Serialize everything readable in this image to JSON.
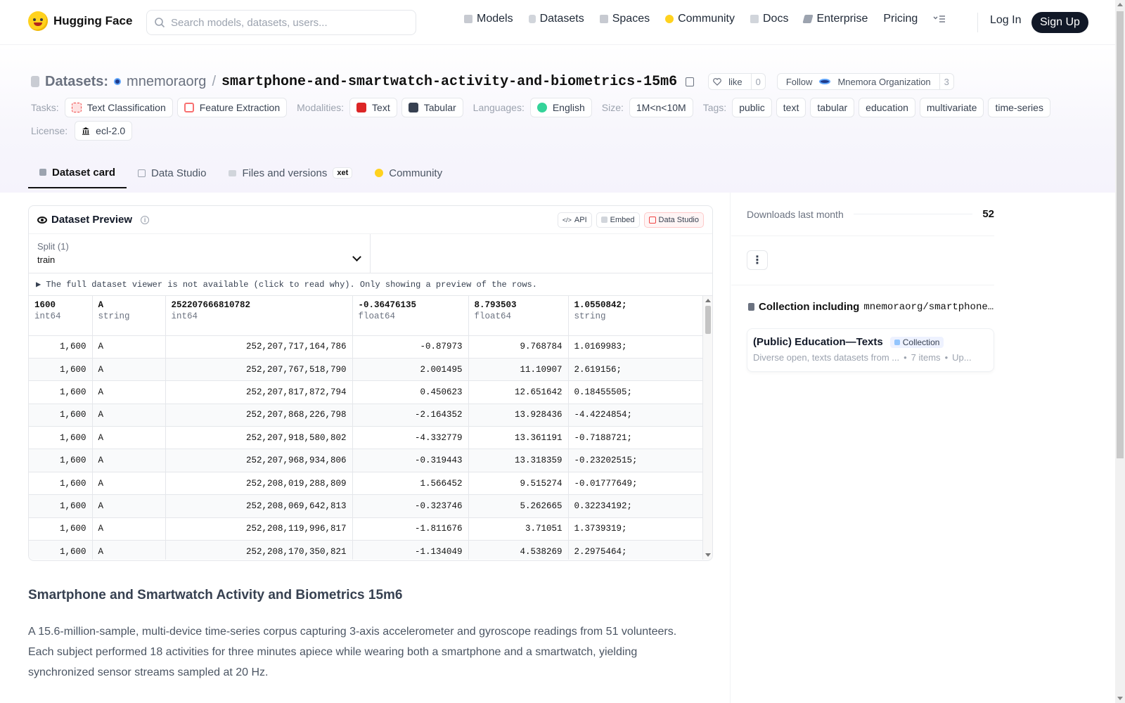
{
  "nav": {
    "brand": "Hugging Face",
    "search_placeholder": "Search models, datasets, users...",
    "links": [
      "Models",
      "Datasets",
      "Spaces",
      "Community",
      "Docs",
      "Enterprise",
      "Pricing"
    ],
    "login": "Log In",
    "signup": "Sign Up"
  },
  "header": {
    "crumb_label": "Datasets:",
    "org": "mnemoraorg",
    "repo": "smartphone-and-smartwatch-activity-and-biometrics-15m6",
    "like_label": "like",
    "like_count": "0",
    "follow_label": "Follow",
    "follow_org": "Mnemora Organization",
    "follow_count": "3"
  },
  "tags": {
    "tasks_label": "Tasks:",
    "tasks": [
      "Text Classification",
      "Feature Extraction"
    ],
    "modalities_label": "Modalities:",
    "modalities": [
      "Text",
      "Tabular"
    ],
    "languages_label": "Languages:",
    "languages": [
      "English"
    ],
    "size_label": "Size:",
    "size": "1M<n<10M",
    "tags_label": "Tags:",
    "tags": [
      "public",
      "text",
      "tabular",
      "education",
      "multivariate",
      "time-series"
    ],
    "license_label": "License:",
    "license": "ecl-2.0"
  },
  "tabs": [
    "Dataset card",
    "Data Studio",
    "Files and versions",
    "Community"
  ],
  "xet_badge": "xet",
  "preview": {
    "title": "Dataset Preview",
    "btn_api": "API",
    "btn_embed": "Embed",
    "btn_studio": "Data Studio",
    "split_label": "Split (1)",
    "split_value": "train",
    "notice": "▶ The full dataset viewer is not available (click to read why). Only showing a preview of the rows.",
    "columns": [
      {
        "name": "1600",
        "dtype": "int64"
      },
      {
        "name": "A",
        "dtype": "string"
      },
      {
        "name": "252207666810782",
        "dtype": "int64"
      },
      {
        "name": "-0.36476135",
        "dtype": "float64"
      },
      {
        "name": "8.793503",
        "dtype": "float64"
      },
      {
        "name": "1.0550842;",
        "dtype": "string"
      }
    ],
    "rows": [
      [
        "1,600",
        "A",
        "252,207,717,164,786",
        "-0.87973",
        "9.768784",
        "1.0169983;"
      ],
      [
        "1,600",
        "A",
        "252,207,767,518,790",
        "2.001495",
        "11.10907",
        "2.619156;"
      ],
      [
        "1,600",
        "A",
        "252,207,817,872,794",
        "0.450623",
        "12.651642",
        "0.18455505;"
      ],
      [
        "1,600",
        "A",
        "252,207,868,226,798",
        "-2.164352",
        "13.928436",
        "-4.4224854;"
      ],
      [
        "1,600",
        "A",
        "252,207,918,580,802",
        "-4.332779",
        "13.361191",
        "-0.7188721;"
      ],
      [
        "1,600",
        "A",
        "252,207,968,934,806",
        "-0.319443",
        "13.318359",
        "-0.23202515;"
      ],
      [
        "1,600",
        "A",
        "252,208,019,288,809",
        "1.566452",
        "9.515274",
        "-0.01777649;"
      ],
      [
        "1,600",
        "A",
        "252,208,069,642,813",
        "-0.323746",
        "5.262665",
        "0.32234192;"
      ],
      [
        "1,600",
        "A",
        "252,208,119,996,817",
        "-1.811676",
        "3.71051",
        "1.3739319;"
      ],
      [
        "1,600",
        "A",
        "252,208,170,350,821",
        "-1.134049",
        "4.538269",
        "2.2975464;"
      ]
    ]
  },
  "card": {
    "heading": "Smartphone and Smartwatch Activity and Biometrics 15m6",
    "paragraph": "A 15.6-million-sample, multi-device time-series corpus capturing 3-axis accelerometer and gyroscope readings from 51 volunteers. Each subject performed 18 activities for three minutes apiece while wearing both a smartphone and a smartwatch, yielding synchronized sensor streams sampled at 20 Hz."
  },
  "sidebar": {
    "downloads_label": "Downloads last month",
    "downloads_value": "52",
    "more_label": "⋮",
    "collection_prefix": "Collection including",
    "collection_repo": "mnemoraorg/smartphone-an...",
    "collection_title": "(Public) Education—Texts",
    "collection_badge": "Collection",
    "collection_desc": "Diverse open, texts datasets from ...",
    "collection_items": "7 items",
    "collection_updated": "Up..."
  },
  "colors": {
    "accent_dark": "#111827",
    "hf_yellow": "#ffd21e"
  }
}
